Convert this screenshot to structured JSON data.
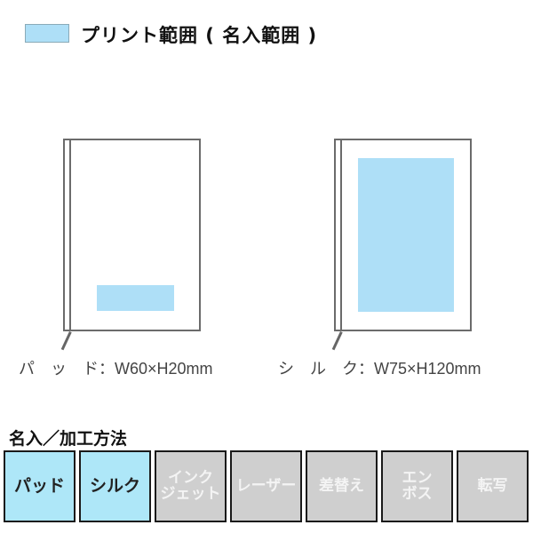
{
  "legend": {
    "swatch_color": "#aedff7",
    "label": "プリント範囲 ( 名入範囲 )"
  },
  "books": [
    {
      "method": "パッド",
      "label": "パ　ッ　ド：W60×H20mm",
      "width_mm": 60,
      "height_mm": 20
    },
    {
      "method": "シルク",
      "label": "シ　ル　ク：W75×H120mm",
      "width_mm": 75,
      "height_mm": 120
    }
  ],
  "methods_section": {
    "title": "名入／加工方法",
    "active_color": "#aee7f8",
    "inactive_color": "#cfcfcf",
    "items": [
      {
        "line1": "パッド",
        "line2": "",
        "available": true
      },
      {
        "line1": "シルク",
        "line2": "",
        "available": true
      },
      {
        "line1": "インク",
        "line2": "ジェット",
        "available": false
      },
      {
        "line1": "レーザー",
        "line2": "",
        "available": false
      },
      {
        "line1": "差替え",
        "line2": "",
        "available": false
      },
      {
        "line1": "エン",
        "line2": "ボス",
        "available": false
      },
      {
        "line1": "転写",
        "line2": "",
        "available": false
      }
    ]
  }
}
